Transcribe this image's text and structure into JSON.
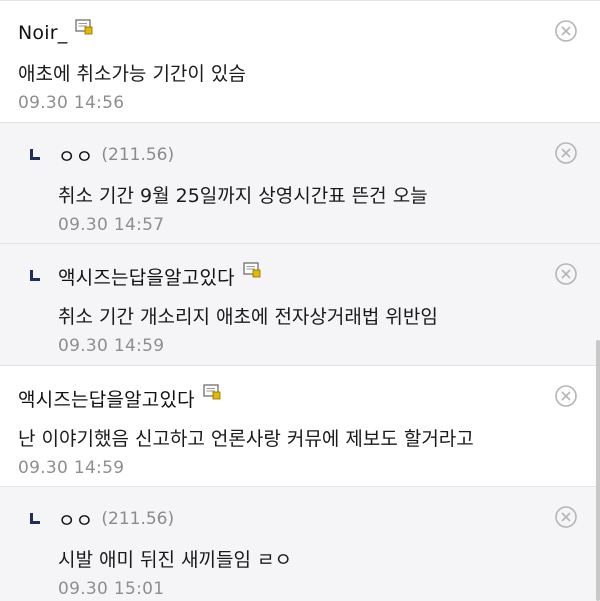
{
  "comments": [
    {
      "type": "comment",
      "author": "Noir_",
      "ip": "",
      "has_memo_icon": true,
      "body": "애초에 취소가능 기간이 있슴",
      "timestamp": "09.30 14:56"
    },
    {
      "type": "reply",
      "author": "ㅇㅇ",
      "ip": "(211.56)",
      "has_memo_icon": false,
      "body": "취소 기간 9월 25일까지 상영시간표 뜬건 오늘",
      "timestamp": "09.30 14:57"
    },
    {
      "type": "reply",
      "author": "액시즈는답을알고있다",
      "ip": "",
      "has_memo_icon": true,
      "body": "취소 기간 개소리지 애초에 전자상거래법 위반임",
      "timestamp": "09.30 14:59"
    },
    {
      "type": "comment",
      "author": "액시즈는답을알고있다",
      "ip": "",
      "has_memo_icon": true,
      "body": "난 이야기했음 신고하고 언론사랑 커뮤에 제보도 할거라고",
      "timestamp": "09.30 14:59"
    },
    {
      "type": "reply",
      "author": "ㅇㅇ",
      "ip": "(211.56)",
      "has_memo_icon": false,
      "body": "시발 애미 뒤진 새끼들임 ㄹㅇ",
      "timestamp": "09.30 15:01"
    }
  ],
  "icons": {
    "delete": "close-circle-icon",
    "memo": "memo-icon",
    "reply": "reply-arrow-icon"
  },
  "colors": {
    "reply_background": "#f5f5f7",
    "divider": "#e3e3e3",
    "timestamp": "#8e8e8e",
    "reply_arrow": "#1f2f5a",
    "memo_accent": "#e6b800"
  }
}
